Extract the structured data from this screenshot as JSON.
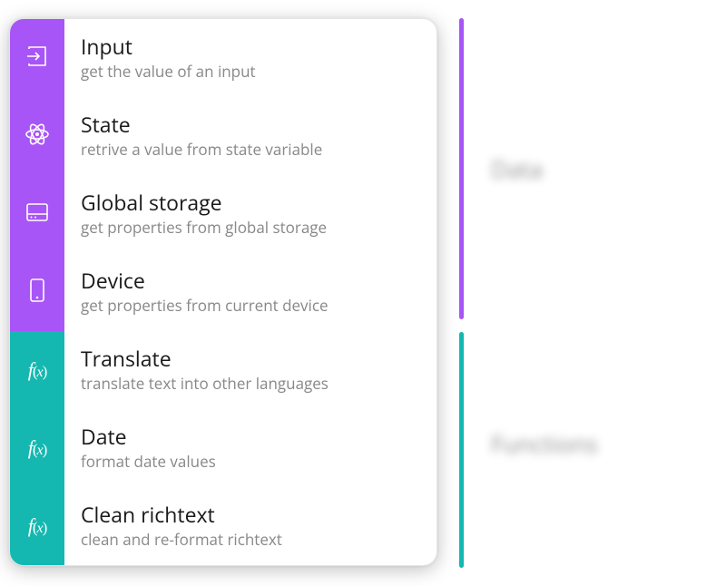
{
  "items": [
    {
      "icon": "input-icon",
      "title": "Input",
      "desc": "get the value of an input",
      "type": "data"
    },
    {
      "icon": "atom-icon",
      "title": "State",
      "desc": "retrive a value from state variable",
      "type": "data"
    },
    {
      "icon": "storage-icon",
      "title": "Global storage",
      "desc": "get properties from global storage",
      "type": "data"
    },
    {
      "icon": "device-icon",
      "title": "Device",
      "desc": "get properties from current device",
      "type": "data"
    },
    {
      "icon": "function-icon",
      "title": "Translate",
      "desc": "translate text into other languages",
      "type": "func"
    },
    {
      "icon": "function-icon",
      "title": "Date",
      "desc": "format date values",
      "type": "func"
    },
    {
      "icon": "function-icon",
      "title": "Clean richtext",
      "desc": "clean and re-format richtext",
      "type": "func"
    }
  ],
  "labels": {
    "data": "Data",
    "functions": "Functions"
  },
  "colors": {
    "data": "#A855F7",
    "func": "#14B8B0"
  }
}
